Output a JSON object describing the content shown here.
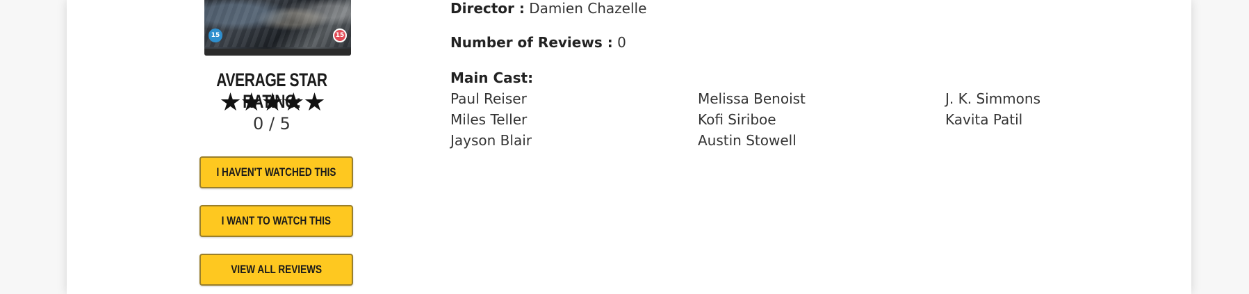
{
  "movie": {
    "director_label": "Director :",
    "director": "Damien Chazelle",
    "reviews_label": "Number of Reviews :",
    "reviews_count": "0",
    "cast_label": "Main Cast:",
    "cast": [
      "Paul Reiser",
      "Melissa Benoist",
      "J. K. Simmons",
      "Miles Teller",
      "Kofi Siriboe",
      "Kavita Patil",
      "Jayson Blair",
      "Austin Stowell"
    ]
  },
  "poster": {
    "age_rating_left": "15",
    "age_rating_right": "15",
    "badge_left_color": "#2f8fce",
    "badge_right_color": "#e14a55"
  },
  "rating": {
    "title": "Average Star Rating:",
    "stars": "★★★★★",
    "rating_value": 0,
    "rating_max": 5,
    "text": "0 / 5"
  },
  "actions": {
    "havent_watched": "I Haven't Watched This",
    "want_to_watch": "I Want To Watch This",
    "view_reviews": "View All Reviews"
  },
  "theme": {
    "button_color": "#fec820",
    "accent_text": "#1a1a1a"
  }
}
